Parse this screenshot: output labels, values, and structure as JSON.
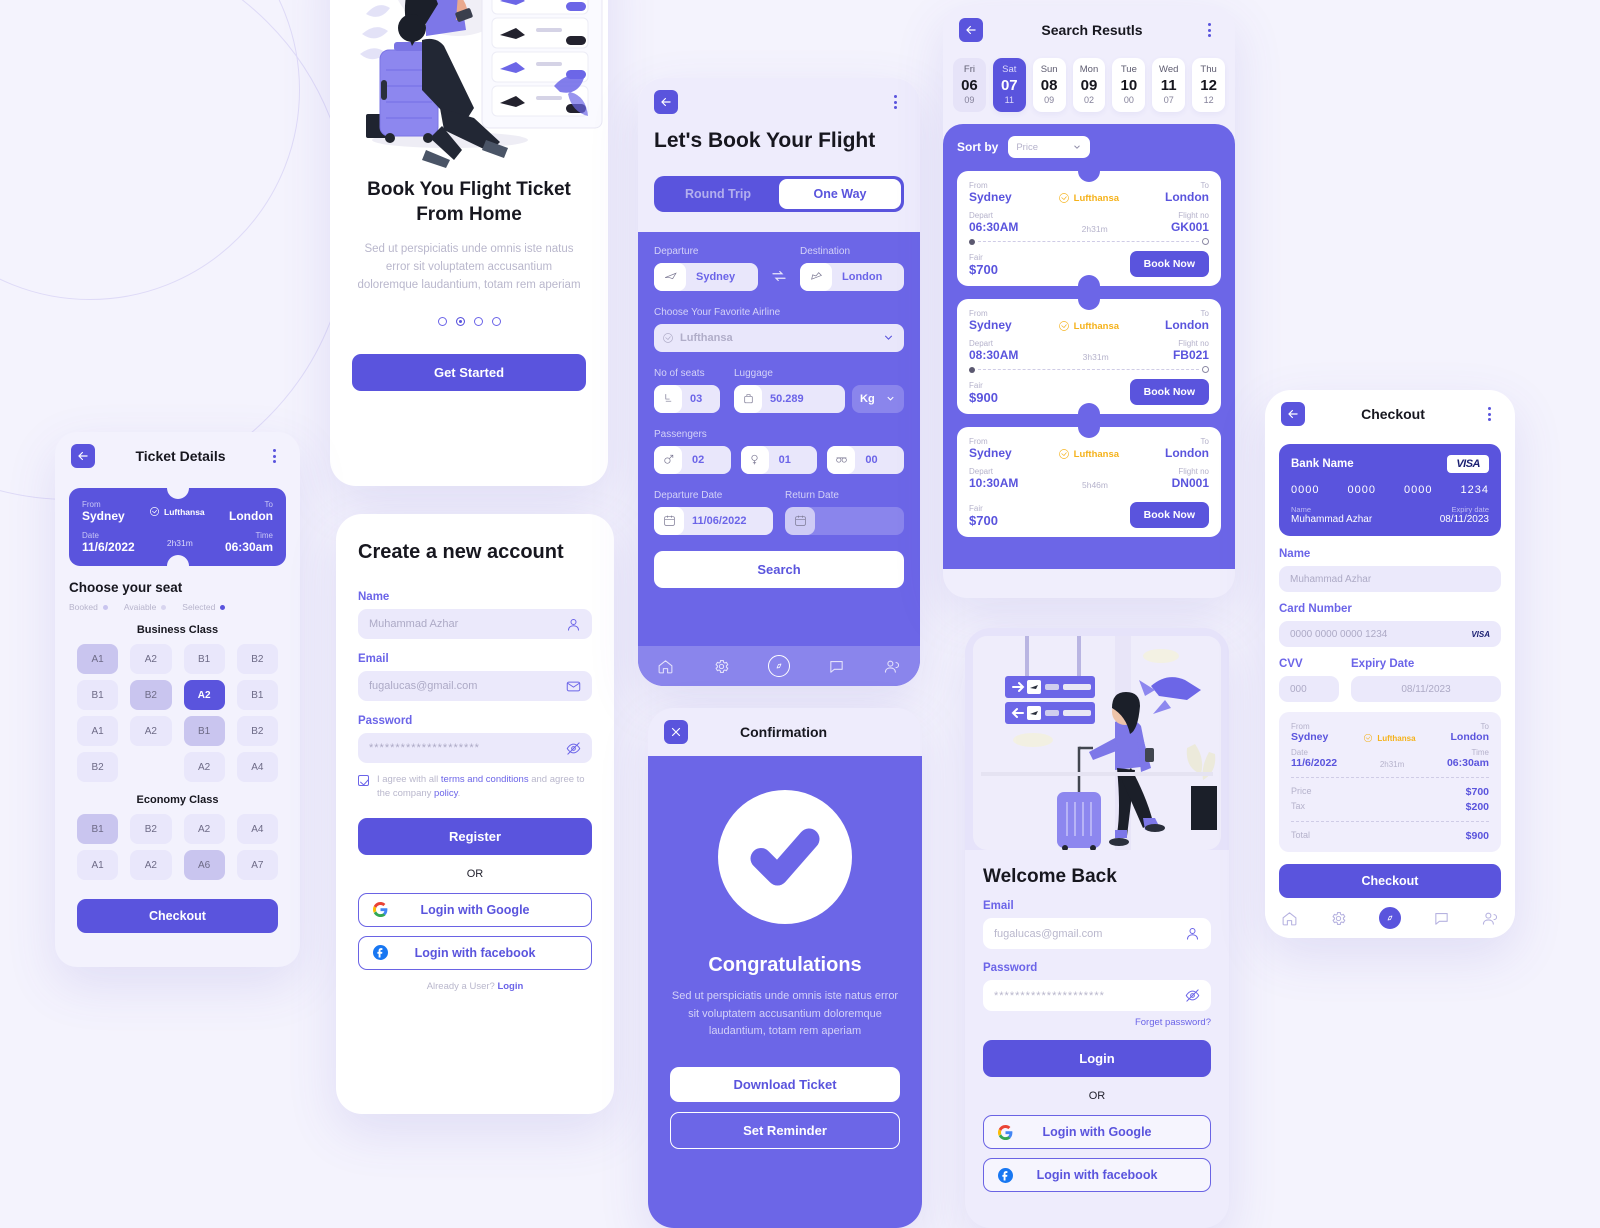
{
  "theme": {
    "accent": "#5a54dd",
    "accent_light": "#6c66e7",
    "bg": "#f4f3fd",
    "gold": "#f5b21b"
  },
  "onboarding": {
    "title": "Book You Flight Ticket From Home",
    "subtitle": "Sed ut perspiciatis unde omnis iste natus error sit voluptatem accusantium doloremque laudantium, totam rem aperiam",
    "dots": 4,
    "active_dot": 1,
    "cta": "Get Started"
  },
  "ticket_details": {
    "header_title": "Ticket Details",
    "ticket": {
      "from_label": "From",
      "from": "Sydney",
      "to_label": "To",
      "to": "London",
      "airline": "Lufthansa",
      "date_label": "Date",
      "date": "11/6/2022",
      "duration": "2h31m",
      "time_label": "Time",
      "time": "06:30am"
    },
    "seat_heading": "Choose your seat",
    "legend": [
      {
        "label": "Booked",
        "color": "#c9c5ef"
      },
      {
        "label": "Avaiable",
        "color": "#e9e7fb"
      },
      {
        "label": "Selected",
        "color": "#5a54dd"
      }
    ],
    "business_label": "Business Class",
    "business_seats": [
      {
        "id": "A1",
        "state": "booked"
      },
      {
        "id": "A2",
        "state": "available"
      },
      {
        "id": "B1",
        "state": "available"
      },
      {
        "id": "B2",
        "state": "available"
      },
      {
        "id": "B1",
        "state": "available"
      },
      {
        "id": "B2",
        "state": "booked"
      },
      {
        "id": "A2",
        "state": "selected"
      },
      {
        "id": "B1",
        "state": "available"
      },
      {
        "id": "A1",
        "state": "available"
      },
      {
        "id": "A2",
        "state": "available"
      },
      {
        "id": "B1",
        "state": "booked"
      },
      {
        "id": "B2",
        "state": "available"
      },
      {
        "id": "B2",
        "state": "available"
      },
      {
        "id": "",
        "state": "empty"
      },
      {
        "id": "A2",
        "state": "available"
      },
      {
        "id": "A4",
        "state": "available"
      }
    ],
    "economy_label": "Economy Class",
    "economy_seats": [
      {
        "id": "B1",
        "state": "booked"
      },
      {
        "id": "B2",
        "state": "available"
      },
      {
        "id": "A2",
        "state": "available"
      },
      {
        "id": "A4",
        "state": "available"
      },
      {
        "id": "A1",
        "state": "available"
      },
      {
        "id": "A2",
        "state": "available"
      },
      {
        "id": "A6",
        "state": "booked"
      },
      {
        "id": "A7",
        "state": "available"
      }
    ],
    "checkout_cta": "Checkout"
  },
  "signup": {
    "title": "Create a new account",
    "name_label": "Name",
    "name_placeholder": "Muhammad Azhar",
    "email_label": "Email",
    "email_placeholder": "fugalucas@gmail.com",
    "password_label": "Password",
    "password_value": "*********************",
    "agree_pre": "I agree with all ",
    "agree_terms": "terms and conditions",
    "agree_mid": " and agree to the company ",
    "agree_policy": "policy",
    "agree_end": ".",
    "register_cta": "Register",
    "or": "OR",
    "google_cta": "Login with Google",
    "facebook_cta": "Login with facebook",
    "already_text": "Already a User? ",
    "already_link": "Login"
  },
  "book_flight": {
    "title": "Let's Book Your Flight",
    "trip_types": [
      {
        "label": "Round Trip",
        "active": false
      },
      {
        "label": "One Way",
        "active": true
      }
    ],
    "departure_label": "Departure",
    "departure_value": "Sydney",
    "destination_label": "Destination",
    "destination_value": "London",
    "airline_label": "Choose Your Favorite Airline",
    "airline_value": "Lufthansa",
    "seats_label": "No of seats",
    "seats_value": "03",
    "luggage_label": "Luggage",
    "luggage_value": "50.289",
    "luggage_unit": "Kg",
    "passengers_label": "Passengers",
    "passengers": [
      {
        "icon": "male-icon",
        "value": "02"
      },
      {
        "icon": "female-icon",
        "value": "01"
      },
      {
        "icon": "child-icon",
        "value": "00"
      }
    ],
    "departure_date_label": "Departure Date",
    "departure_date_value": "11/06/2022",
    "return_date_label": "Return Date",
    "return_date_value": "",
    "search_cta": "Search"
  },
  "search_results": {
    "header_title": "Search Resutls",
    "dates": [
      {
        "weekday": "Fri",
        "day": "06",
        "num": "09",
        "state": "muted"
      },
      {
        "weekday": "Sat",
        "day": "07",
        "num": "11",
        "state": "active"
      },
      {
        "weekday": "Sun",
        "day": "08",
        "num": "09",
        "state": "normal"
      },
      {
        "weekday": "Mon",
        "day": "09",
        "num": "02",
        "state": "normal"
      },
      {
        "weekday": "Tue",
        "day": "10",
        "num": "00",
        "state": "normal"
      },
      {
        "weekday": "Wed",
        "day": "11",
        "num": "07",
        "state": "normal"
      },
      {
        "weekday": "Thu",
        "day": "12",
        "num": "12",
        "state": "normal"
      }
    ],
    "sort_label": "Sort by",
    "sort_value": "Price",
    "labels": {
      "from": "From",
      "to": "To",
      "depart": "Depart",
      "flight_no": "Flight no",
      "fair": "Fair"
    },
    "flights": [
      {
        "from": "Sydney",
        "to": "London",
        "airline": "Lufthansa",
        "depart": "06:30AM",
        "duration": "2h31m",
        "flight_no": "GK001",
        "fair": "$700",
        "cta": "Book Now"
      },
      {
        "from": "Sydney",
        "to": "London",
        "airline": "Lufthansa",
        "depart": "08:30AM",
        "duration": "3h31m",
        "flight_no": "FB021",
        "fair": "$900",
        "cta": "Book Now"
      },
      {
        "from": "Sydney",
        "to": "London",
        "airline": "Lufthansa",
        "depart": "10:30AM",
        "duration": "5h46m",
        "flight_no": "DN001",
        "fair": "$700",
        "cta": "Book Now"
      }
    ]
  },
  "confirmation": {
    "header_title": "Confirmation",
    "heading": "Congratulations",
    "body": "Sed ut perspiciatis unde omnis iste natus error sit voluptatem accusantium doloremque laudantium, totam rem aperiam",
    "download_cta": "Download Ticket",
    "reminder_cta": "Set Reminder"
  },
  "login": {
    "title": "Welcome Back",
    "email_label": "Email",
    "email_placeholder": "fugalucas@gmail.com",
    "password_label": "Password",
    "password_value": "*********************",
    "forget": "Forget password?",
    "login_cta": "Login",
    "or": "OR",
    "google_cta": "Login with Google",
    "facebook_cta": "Login with facebook"
  },
  "checkout": {
    "header_title": "Checkout",
    "card": {
      "bank_name": "Bank Name",
      "brand": "VISA",
      "groups": [
        "0000",
        "0000",
        "0000",
        "1234"
      ],
      "name_label": "Name",
      "name": "Muhammad Azhar",
      "expiry_label": "Expiry date",
      "expiry": "08/11/2023"
    },
    "name_label": "Name",
    "name_placeholder": "Muhammad Azhar",
    "card_label": "Card Number",
    "card_placeholder": "0000  0000  0000  1234",
    "cvv_label": "CVV",
    "cvv_placeholder": "000",
    "expiry_label": "Expiry Date",
    "expiry_placeholder": "08/11/2023",
    "summary": {
      "from_label": "From",
      "from": "Sydney",
      "to_label": "To",
      "to": "London",
      "airline": "Lufthansa",
      "date_label": "Date",
      "date": "11/6/2022",
      "duration": "2h31m",
      "time_label": "Time",
      "time": "06:30am",
      "price_label": "Price",
      "price": "$700",
      "tax_label": "Tax",
      "tax": "$200",
      "total_label": "Total",
      "total": "$900"
    },
    "checkout_cta": "Checkout"
  },
  "navbar": {
    "items": [
      {
        "icon": "home-icon",
        "active": false
      },
      {
        "icon": "gear-icon",
        "active": false
      },
      {
        "icon": "compass-icon",
        "active": true
      },
      {
        "icon": "chat-icon",
        "active": false
      },
      {
        "icon": "people-icon",
        "active": false
      }
    ]
  }
}
